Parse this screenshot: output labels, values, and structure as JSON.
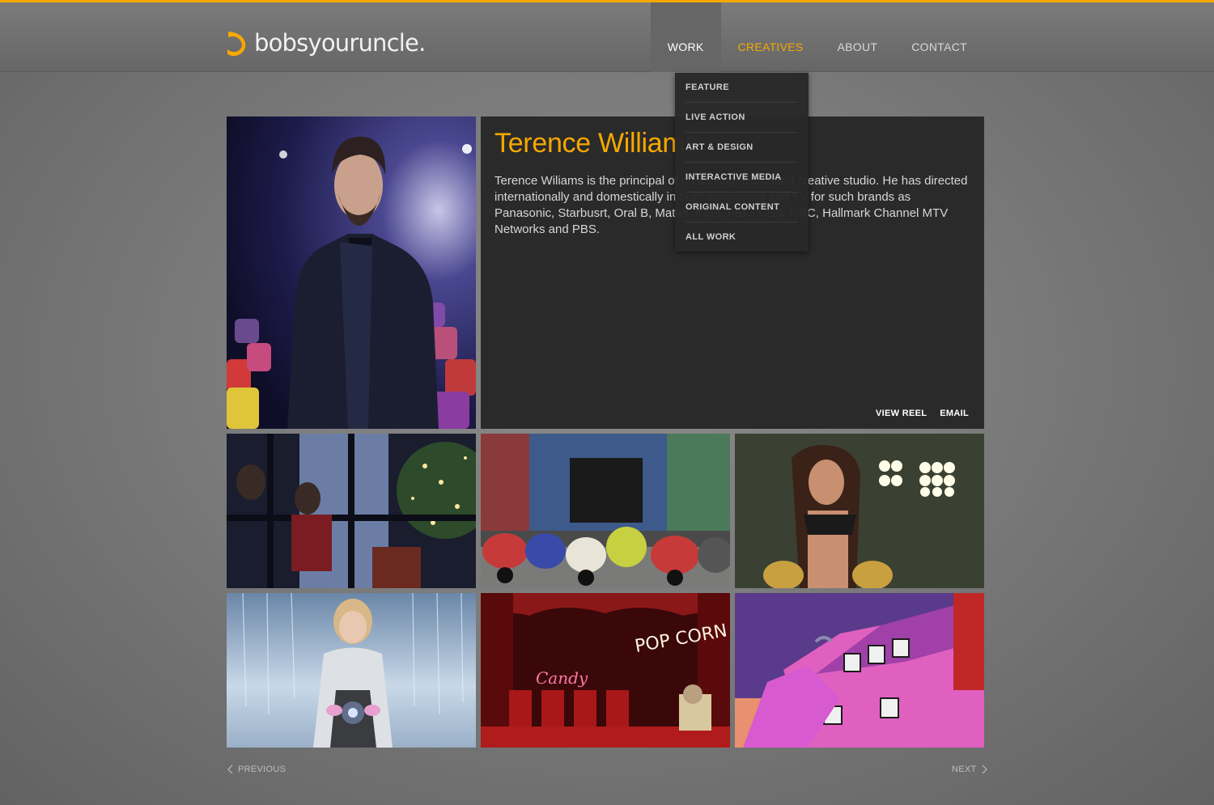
{
  "brand": {
    "logo_text": "bobsyouruncle.",
    "accent_color": "#f6a800"
  },
  "nav": {
    "items": [
      {
        "label": "WORK",
        "state": "active"
      },
      {
        "label": "CREATIVES",
        "state": "highlighted"
      },
      {
        "label": "ABOUT",
        "state": "normal"
      },
      {
        "label": "CONTACT",
        "state": "normal"
      }
    ]
  },
  "work_menu": {
    "items": [
      "FEATURE",
      "LIVE ACTION",
      "ART & DESIGN",
      "INTERACTIVE MEDIA",
      "ORIGINAL CONTENT",
      "ALL WORK"
    ]
  },
  "profile": {
    "name": "Terence Williams",
    "bio": "Terence Wiliams is the principal of a Los Angeles based creative studio. He has directed internationally and domestically in both advertising and TV for such brands as Panasonic, Starbusrt, Oral B, Mattel, Kraft, ABC, CBS, NBC, Hallmark Channel MTV Networks and PBS.",
    "actions": {
      "view_reel": "VIEW REEL",
      "email": "EMAIL"
    }
  },
  "gallery": {
    "thumbnails": [
      {
        "icon": "christmas-window-thumbnail"
      },
      {
        "icon": "scooters-garage-thumbnail"
      },
      {
        "icon": "cheerleader-stadium-thumbnail"
      },
      {
        "icon": "girl-snow-thumbnail"
      },
      {
        "icon": "candy-popcorn-theater-thumbnail"
      },
      {
        "icon": "cartoon-house-thumbnail"
      }
    ]
  },
  "pagination": {
    "previous": "PREVIOUS",
    "next": "NEXT"
  }
}
